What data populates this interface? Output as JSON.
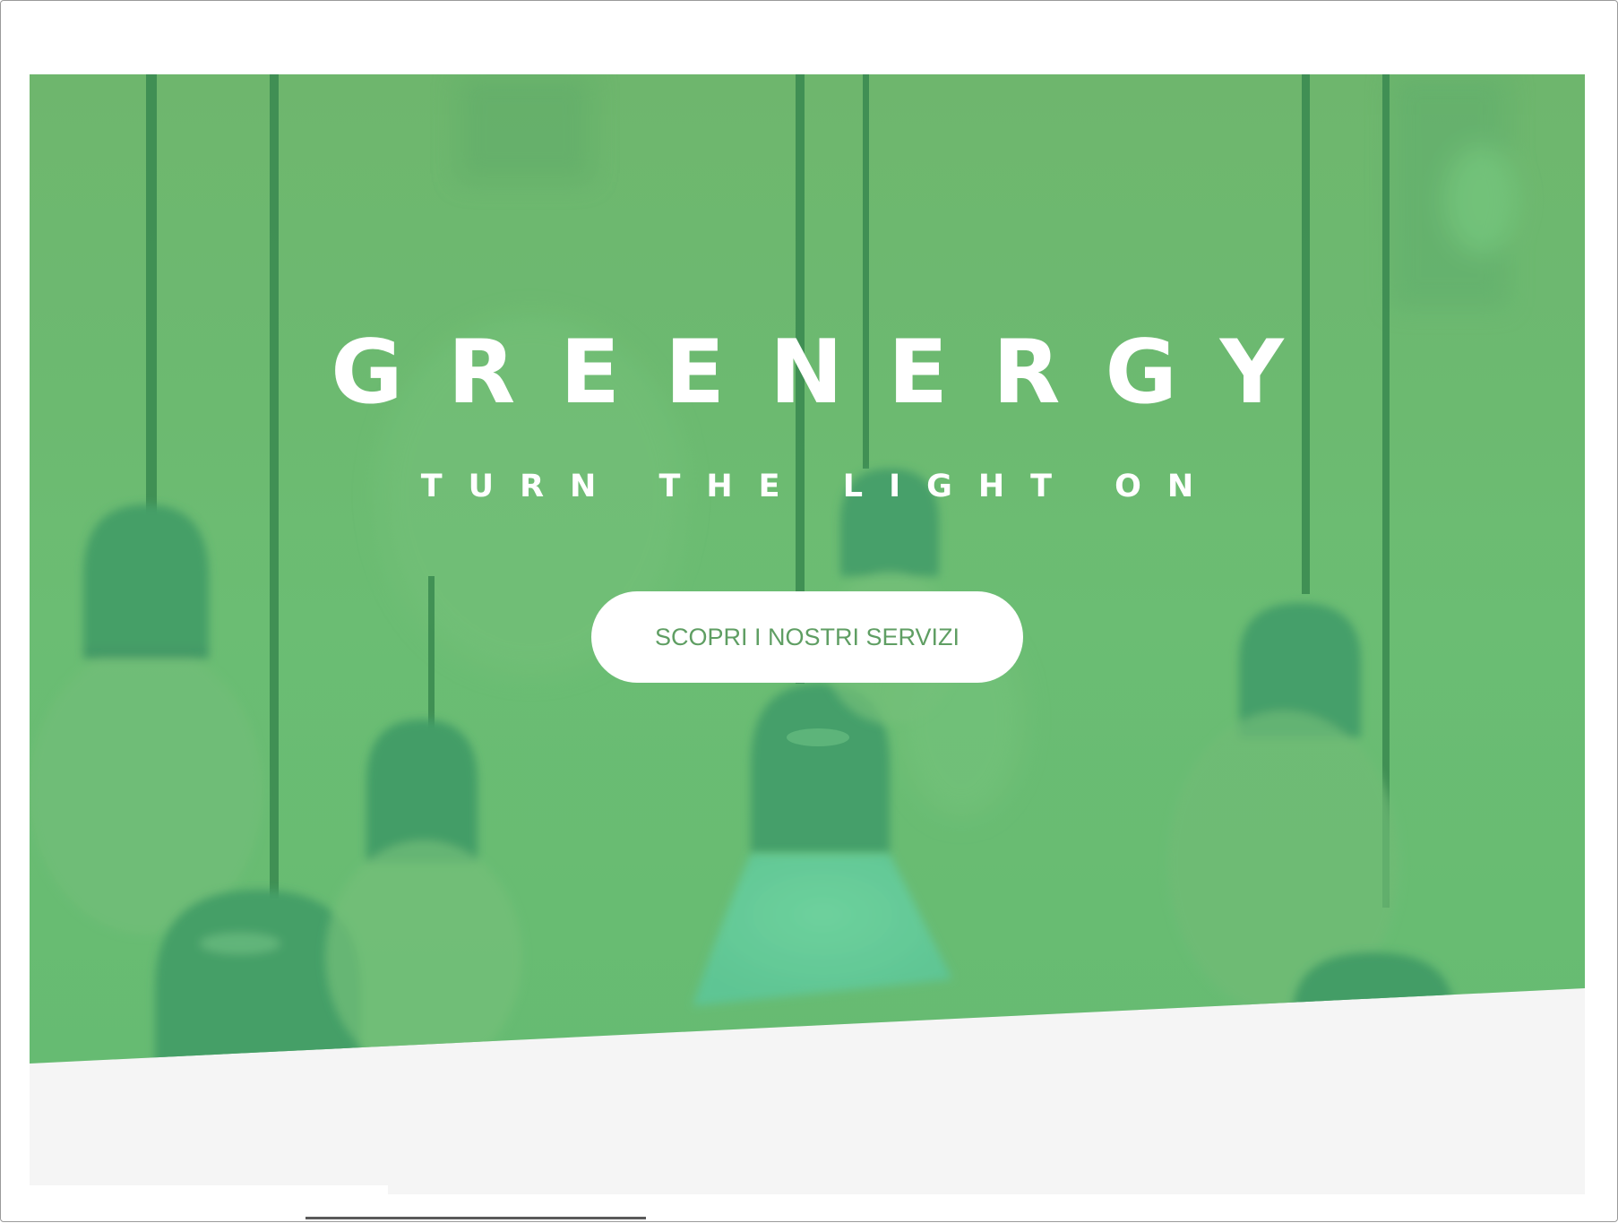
{
  "hero": {
    "title": "GREENERGY",
    "subtitle": "TURN THE LIGHT ON",
    "cta_label": "SCOPRI I NOSTRI SERVIZI"
  },
  "colors": {
    "hero_green": "#6cb86f",
    "bulb_dark_green": "#3d9968",
    "bulb_glow": "#65cc9c",
    "button_text": "#5f9e63",
    "section_background": "#f5f5f5"
  },
  "icons": {
    "background": "hanging-light-bulbs-image"
  }
}
